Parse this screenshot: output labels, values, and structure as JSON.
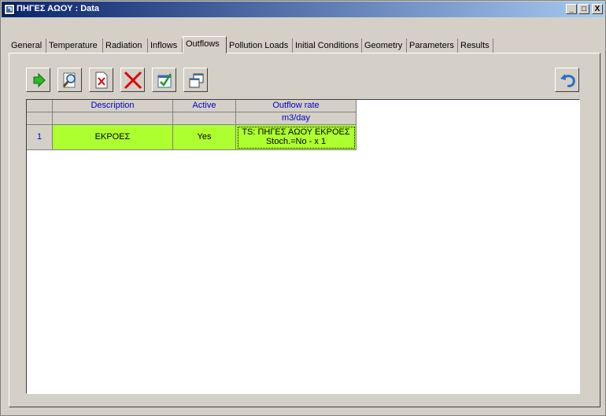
{
  "window": {
    "title": "ΠΗΓΕΣ ΑΩΟΥ : Data",
    "accent": "#0a246a",
    "controls": [
      "_",
      "□",
      "X"
    ]
  },
  "tabs": [
    {
      "label": "General"
    },
    {
      "label": "Temperature"
    },
    {
      "label": "Radiation"
    },
    {
      "label": "Inflows"
    },
    {
      "label": "Outflows",
      "active": true
    },
    {
      "label": "Pollution Loads"
    },
    {
      "label": "Initial Conditions"
    },
    {
      "label": "Geometry"
    },
    {
      "label": "Parameters"
    },
    {
      "label": "Results"
    }
  ],
  "toolbar": {
    "buttons": [
      "green-arrow-icon",
      "magnify-icon",
      "delete-doc-icon",
      "red-x-icon",
      "checklist-icon",
      "copy-windows-icon"
    ],
    "undo": "undo-arrow-icon"
  },
  "table": {
    "columns": [
      {
        "label": "Description",
        "unit": ""
      },
      {
        "label": "Active",
        "unit": ""
      },
      {
        "label": "Outflow rate",
        "unit": "m3/day"
      }
    ],
    "rows": [
      {
        "num": "1",
        "description": "ΕΚΡΟΕΣ",
        "active": "Yes",
        "outflow_line1": "TS: ΠΗΓΕΣ ΑΩΟΥ ΕΚΡΟΕΣ",
        "outflow_line2": "Stoch.=No  -  x 1"
      }
    ],
    "row_color": "#adff2f"
  }
}
